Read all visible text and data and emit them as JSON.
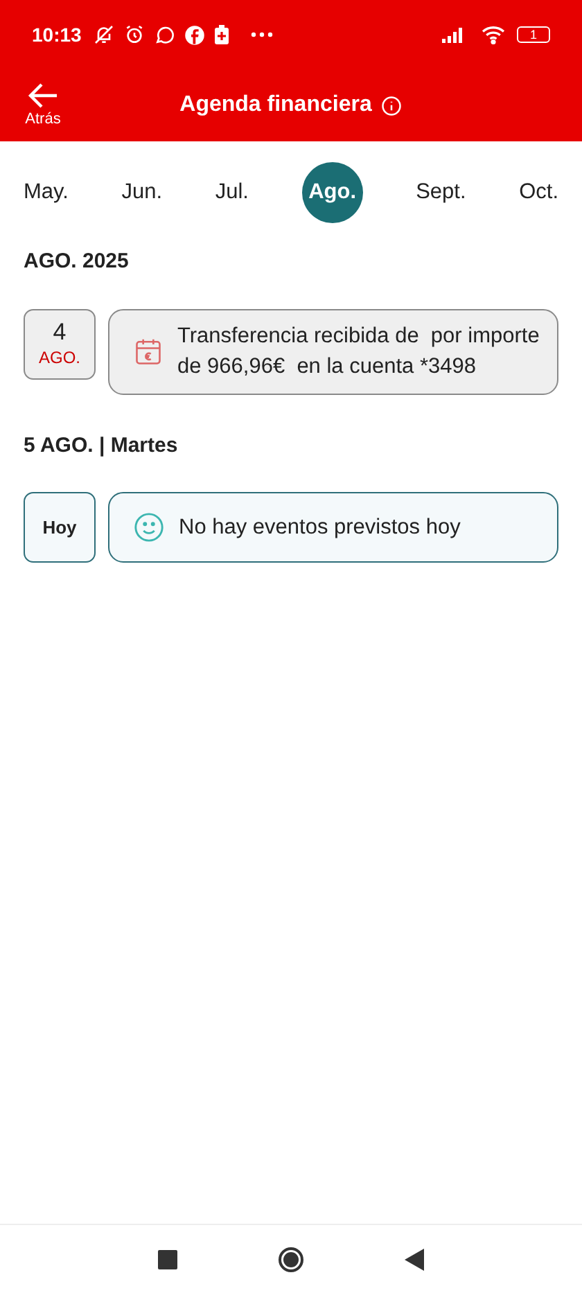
{
  "status_bar": {
    "time": "10:13",
    "battery": "1"
  },
  "header": {
    "back_label": "Atrás",
    "title": "Agenda financiera"
  },
  "months": [
    {
      "label": "May.",
      "selected": false
    },
    {
      "label": "Jun.",
      "selected": false
    },
    {
      "label": "Jul.",
      "selected": false
    },
    {
      "label": "Ago.",
      "selected": true
    },
    {
      "label": "Sept.",
      "selected": false
    },
    {
      "label": "Oct.",
      "selected": false
    }
  ],
  "sections": [
    {
      "heading": "AGO. 2025",
      "entries": [
        {
          "kind": "event",
          "day": "4",
          "month": "AGO.",
          "text": "Transferencia recibida de  por importe de 966,96€  en la cuenta *3498"
        }
      ]
    },
    {
      "heading": "5 AGO. | Martes",
      "entries": [
        {
          "kind": "today",
          "day": "Hoy",
          "text": "No hay eventos previstos hoy"
        }
      ]
    }
  ]
}
